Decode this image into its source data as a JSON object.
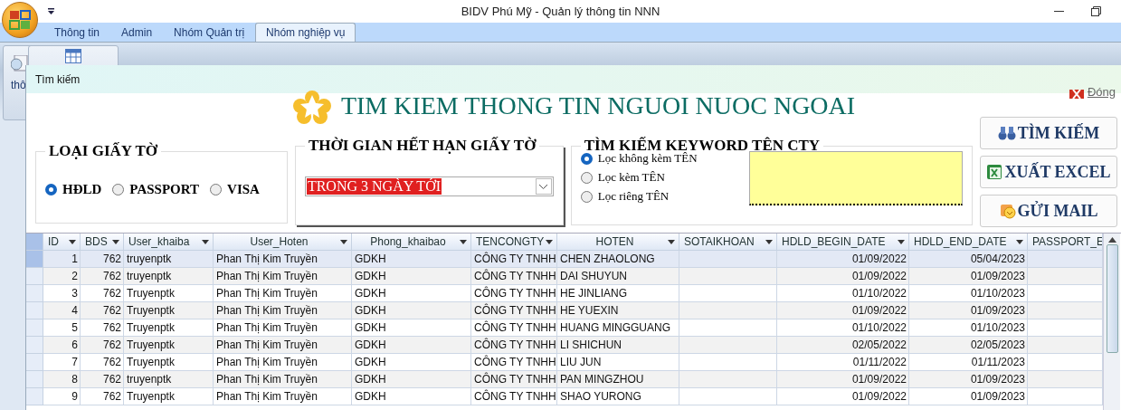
{
  "window": {
    "title": "BIDV Phú Mỹ - Quản lý thông tin NNN"
  },
  "ribbon": {
    "tabs": [
      {
        "label": "Thông tin",
        "selected": false
      },
      {
        "label": "Admin",
        "selected": false
      },
      {
        "label": "Nhóm Quản trị",
        "selected": false
      },
      {
        "label": "Nhóm nghiệp vụ",
        "selected": true
      }
    ],
    "partial_label": "thô"
  },
  "dialog": {
    "title": "Tìm kiếm",
    "heading": "TIM KIEM THONG TIN NGUOI NUOC NGOAI",
    "close_label": "Đóng",
    "doc_type": {
      "title": "LOẠI GIẤY TỜ",
      "options": [
        {
          "label": "HĐLD",
          "selected": true
        },
        {
          "label": "PASSPORT",
          "selected": false
        },
        {
          "label": "VISA",
          "selected": false
        }
      ]
    },
    "expiry": {
      "title": "THỜI GIAN HẾT HẠN GIẤY TỜ",
      "value": "TRONG 3 NGÀY TỚI"
    },
    "keyword": {
      "title": "TÌM KIẾM KEYWORD TÊN CTY",
      "options": [
        {
          "label": "Lọc không kèm TÊN",
          "selected": true
        },
        {
          "label": "Lọc kèm TÊN",
          "selected": false
        },
        {
          "label": "Lọc riêng TÊN",
          "selected": false
        }
      ]
    },
    "buttons": [
      {
        "label": "TÌM KIẾM",
        "kind": "search"
      },
      {
        "label": "XUẤT EXCEL",
        "kind": "excel"
      },
      {
        "label": "GỬI MAIL",
        "kind": "mail"
      }
    ]
  },
  "table": {
    "columns": [
      {
        "label": "ID"
      },
      {
        "label": "BDS"
      },
      {
        "label": "User_khaiba"
      },
      {
        "label": "User_Hoten"
      },
      {
        "label": "Phong_khaibao"
      },
      {
        "label": "TENCONGTY"
      },
      {
        "label": "HOTEN"
      },
      {
        "label": "SOTAIKHOAN"
      },
      {
        "label": "HDLD_BEGIN_DATE"
      },
      {
        "label": "HDLD_END_DATE"
      },
      {
        "label": "PASSPORT_E"
      }
    ],
    "rows": [
      {
        "selected": true,
        "cells": [
          "1",
          "762",
          "truyenptk",
          "Phan Thị Kim Truyền",
          "GDKH",
          "CÔNG TY TNHH",
          "CHEN ZHAOLONG",
          "",
          "01/09/2022",
          "05/04/2023",
          ""
        ]
      },
      {
        "selected": false,
        "cells": [
          "2",
          "762",
          "truyenptk",
          "Phan Thị Kim Truyền",
          "GDKH",
          "CÔNG TY TNHH",
          "DAI SHUYUN",
          "",
          "01/09/2022",
          "01/09/2023",
          ""
        ]
      },
      {
        "selected": false,
        "cells": [
          "3",
          "762",
          "Truyenptk",
          "Phan Thị Kim Truyền",
          "GDKH",
          "CÔNG TY TNHH",
          "HE JINLIANG",
          "",
          "01/10/2022",
          "01/10/2023",
          ""
        ]
      },
      {
        "selected": false,
        "cells": [
          "4",
          "762",
          "Truyenptk",
          "Phan Thị Kim Truyền",
          "GDKH",
          "CÔNG TY TNHH",
          "HE YUEXIN",
          "",
          "01/09/2022",
          "01/09/2023",
          ""
        ]
      },
      {
        "selected": false,
        "cells": [
          "5",
          "762",
          "Truyenptk",
          "Phan Thị Kim Truyền",
          "GDKH",
          "CÔNG TY TNHH",
          "HUANG MINGGUANG",
          "",
          "01/10/2022",
          "01/10/2023",
          ""
        ]
      },
      {
        "selected": false,
        "cells": [
          "6",
          "762",
          "Truyenptk",
          "Phan Thị Kim Truyền",
          "GDKH",
          "CÔNG TY TNHH",
          "LI SHICHUN",
          "",
          "02/05/2022",
          "02/05/2023",
          ""
        ]
      },
      {
        "selected": false,
        "cells": [
          "7",
          "762",
          "Truyenptk",
          "Phan Thị Kim Truyền",
          "GDKH",
          "CÔNG TY TNHH",
          "LIU JUN",
          "",
          "01/11/2022",
          "01/11/2023",
          ""
        ]
      },
      {
        "selected": false,
        "cells": [
          "8",
          "762",
          "truyenptk",
          "Phan Thị Kim Truyền",
          "GDKH",
          "CÔNG TY TNHH",
          "PAN MINGZHOU",
          "",
          "01/09/2022",
          "01/09/2023",
          ""
        ]
      },
      {
        "selected": false,
        "cells": [
          "9",
          "762",
          "Truyenptk",
          "Phan Thị Kim Truyền",
          "GDKH",
          "CÔNG TY TNHH",
          "SHAO YURONG",
          "",
          "01/09/2022",
          "01/09/2023",
          ""
        ]
      }
    ]
  }
}
